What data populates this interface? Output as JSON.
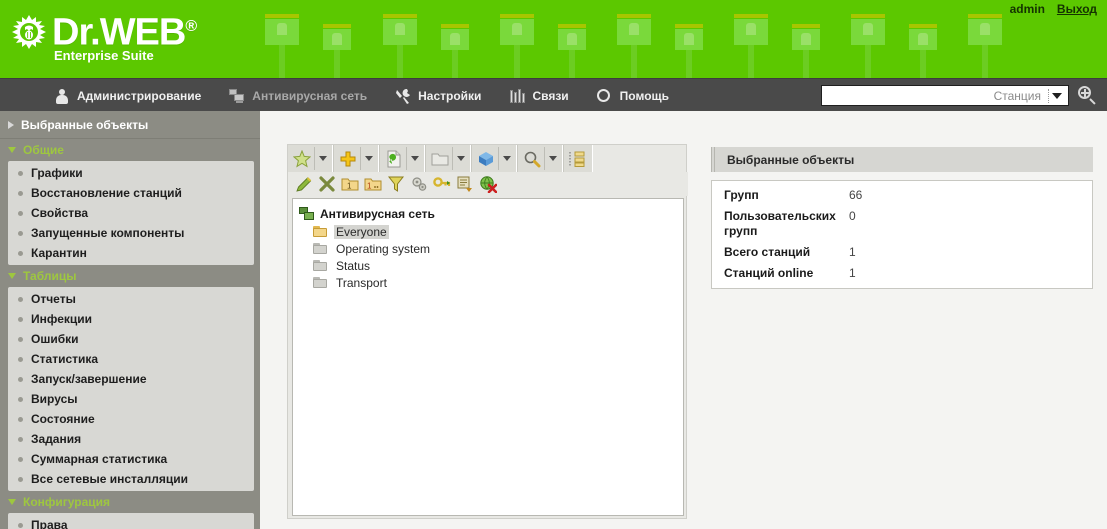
{
  "header": {
    "brand": "Dr.WEB",
    "brand_reg": "®",
    "subtitle": "Enterprise Suite",
    "user": "admin",
    "logout": "Выход",
    "bg_color": "#5cc800",
    "plug_color": "#7ad93b"
  },
  "nav": {
    "items": [
      {
        "label": "Администрирование",
        "icon": "user-icon",
        "active": false
      },
      {
        "label": "Антивирусная сеть",
        "icon": "network-icon",
        "active": true
      },
      {
        "label": "Настройки",
        "icon": "wrench-icon",
        "active": false
      },
      {
        "label": "Связи",
        "icon": "books-icon",
        "active": false
      },
      {
        "label": "Помощь",
        "icon": "help-ring-icon",
        "active": false
      }
    ],
    "bar_color": "#4a4a4a"
  },
  "search": {
    "value": "",
    "placeholder": "",
    "scope": "Станция",
    "go_icon": "search-zoom-icon"
  },
  "sidebar": {
    "header": "Выбранные объекты",
    "groups": [
      {
        "title": "Общие",
        "items": [
          "Графики",
          "Восстановление станций",
          "Свойства",
          "Запущенные компоненты",
          "Карантин"
        ]
      },
      {
        "title": "Таблицы",
        "items": [
          "Отчеты",
          "Инфекции",
          "Ошибки",
          "Статистика",
          "Запуск/завершение",
          "Вирусы",
          "Состояние",
          "Задания",
          "Суммарная статистика",
          "Все сетевые инсталляции"
        ]
      },
      {
        "title": "Конфигурация",
        "items": [
          "Права"
        ]
      }
    ]
  },
  "toolbar": {
    "row1": [
      {
        "icon": "star-icon",
        "caret": true
      },
      {
        "icon": "plus-add-icon",
        "caret": true
      },
      {
        "icon": "page-refresh-icon",
        "caret": true
      },
      {
        "icon": "folder-icon",
        "caret": true
      },
      {
        "icon": "blue-cube-icon",
        "caret": true
      },
      {
        "icon": "magnifier-icon",
        "caret": true
      },
      {
        "icon": "tree-list-icon",
        "caret": false
      }
    ],
    "row2": [
      {
        "icon": "pencil-edit-icon"
      },
      {
        "icon": "delete-x-icon"
      },
      {
        "icon": "folder-one-icon"
      },
      {
        "icon": "folder-one-dots-icon"
      },
      {
        "icon": "merge-funnel-icon"
      },
      {
        "icon": "gears-icon"
      },
      {
        "icon": "key-icon"
      },
      {
        "icon": "list-arrow-icon"
      },
      {
        "icon": "globe-remove-icon"
      }
    ]
  },
  "tree": {
    "root": {
      "label": "Антивирусная сеть",
      "icon": "network-green-icon"
    },
    "children": [
      {
        "label": "Everyone",
        "icon": "folder-yellow-icon",
        "selected": true
      },
      {
        "label": "Operating system",
        "icon": "folder-gray-icon",
        "selected": false
      },
      {
        "label": "Status",
        "icon": "folder-gray-icon",
        "selected": false
      },
      {
        "label": "Transport",
        "icon": "folder-gray-icon",
        "selected": false
      }
    ]
  },
  "info_panel": {
    "title": "Выбранные объекты",
    "rows": [
      {
        "label": "Групп",
        "value": "66"
      },
      {
        "label": "Пользовательских групп",
        "value": "0"
      },
      {
        "label": "Всего станций",
        "value": "1"
      },
      {
        "label": "Станций online",
        "value": "1"
      }
    ]
  }
}
